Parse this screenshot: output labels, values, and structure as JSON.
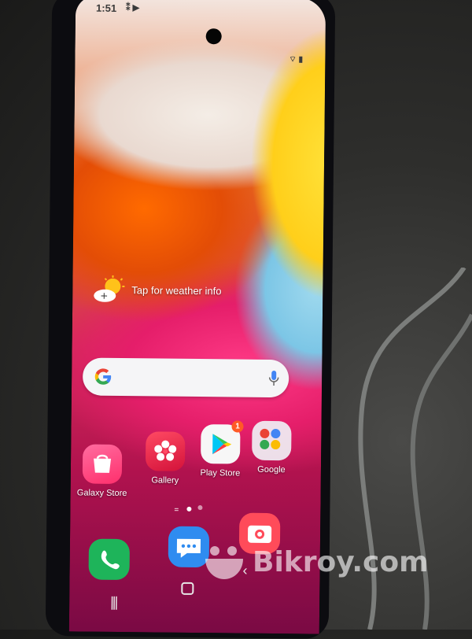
{
  "status_bar": {
    "time": "1:51"
  },
  "weather": {
    "label": "Tap for weather info"
  },
  "apps": [
    {
      "label": "Galaxy Store",
      "icon": "galaxy-store-icon"
    },
    {
      "label": "Gallery",
      "icon": "gallery-icon"
    },
    {
      "label": "Play Store",
      "icon": "play-store-icon",
      "badge": "1"
    },
    {
      "label": "Google",
      "icon": "google-folder-icon"
    }
  ],
  "dock": [
    {
      "icon": "phone-icon"
    },
    {
      "icon": "messages-icon"
    },
    {
      "icon": "camera-icon"
    }
  ],
  "navigation": {
    "buttons": [
      "recents-button",
      "home-button",
      "back-button"
    ]
  },
  "watermark": {
    "text": "Bikroy.com"
  },
  "colors": {
    "search_bar_bg": "#f5f5f7",
    "play_badge": "#ff5a26",
    "phone_app": "#1eb45a",
    "messages_app": "#2f8cf0",
    "camera_app": "#ff4b5a",
    "galaxy_store": "#ff3f7a",
    "gallery": "#ea2a4a"
  }
}
